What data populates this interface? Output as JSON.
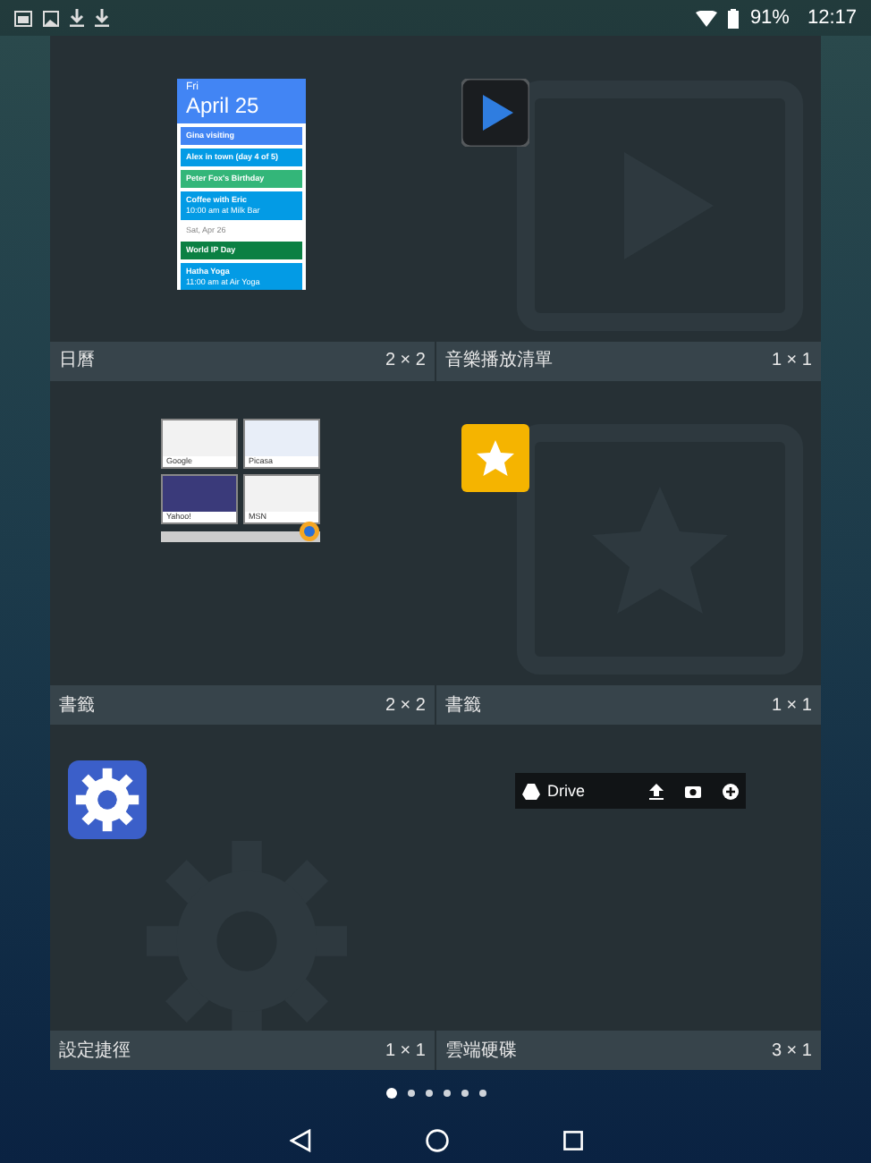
{
  "status_bar": {
    "battery": "91%",
    "time": "12:17"
  },
  "widgets": [
    {
      "name": "日曆",
      "size": "2 × 2",
      "preview": {
        "kind": "calendar",
        "day": "Fri",
        "date": "April 25",
        "events": [
          {
            "kind": "event",
            "title": "Gina visiting",
            "color": "#4285f4"
          },
          {
            "kind": "event",
            "title": "Alex in town (day 4 of 5)",
            "color": "#039be5"
          },
          {
            "kind": "event",
            "title": "Peter Fox's Birthday",
            "color": "#33b679"
          },
          {
            "kind": "event",
            "title": "Coffee with Eric",
            "detail": "10:00 am at Milk Bar",
            "color": "#039be5"
          },
          {
            "kind": "header",
            "title": "Sat, Apr 26"
          },
          {
            "kind": "event",
            "title": "World IP Day",
            "color": "#0b8043"
          },
          {
            "kind": "event",
            "title": "Hatha Yoga",
            "detail": "11:00 am at Air Yoga",
            "color": "#039be5"
          }
        ]
      }
    },
    {
      "name": "音樂播放清單",
      "size": "1 × 1",
      "preview": {
        "kind": "play"
      }
    },
    {
      "name": "書籤",
      "size": "2 × 2",
      "preview": {
        "kind": "thumbnails",
        "items": [
          {
            "label": "Google"
          },
          {
            "label": "Picasa"
          },
          {
            "label": "Yahoo!"
          },
          {
            "label": "MSN"
          }
        ]
      }
    },
    {
      "name": "書籤",
      "size": "1 × 1",
      "preview": {
        "kind": "star"
      }
    },
    {
      "name": "設定捷徑",
      "size": "1 × 1",
      "preview": {
        "kind": "gear"
      }
    },
    {
      "name": "雲端硬碟",
      "size": "3 × 1",
      "preview": {
        "kind": "drive",
        "title": "Drive"
      }
    }
  ],
  "pager": [
    {
      "selected": true
    },
    {
      "selected": false
    },
    {
      "selected": false
    },
    {
      "selected": false
    },
    {
      "selected": false
    },
    {
      "selected": false
    }
  ]
}
